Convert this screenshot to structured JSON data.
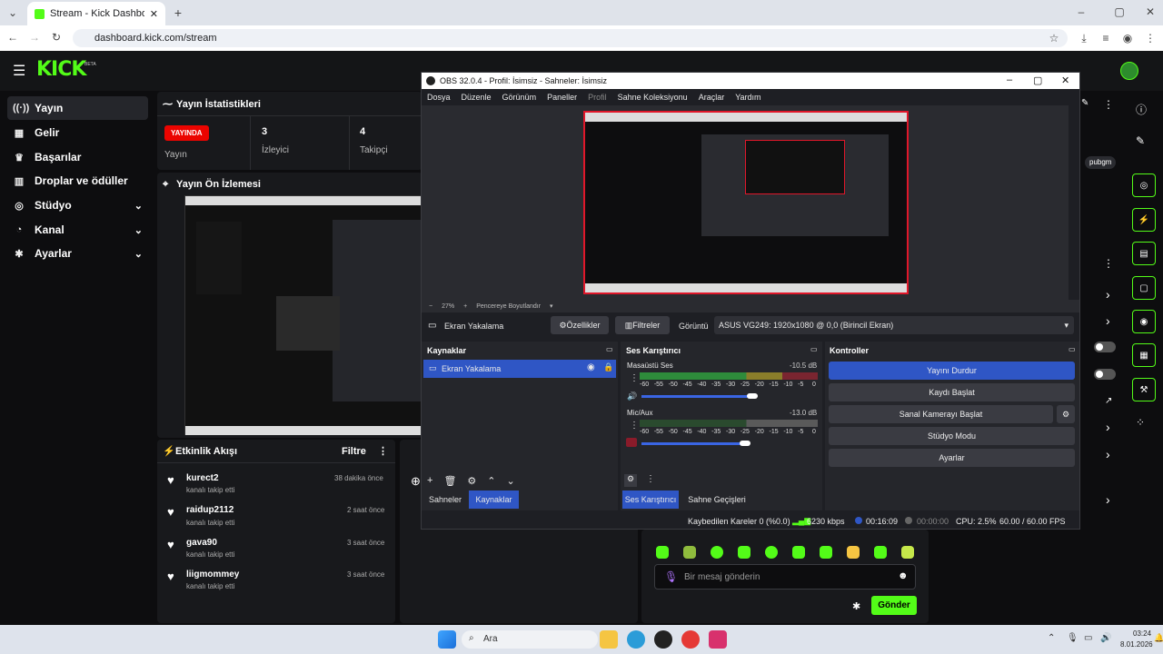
{
  "browser": {
    "tab_title": "Stream - Kick Dashboard",
    "url": "dashboard.kick.com/stream"
  },
  "kick": {
    "logo": "KICK",
    "beta": "BETA",
    "nav": [
      {
        "label": "Yayın",
        "icon": "broadcast-icon"
      },
      {
        "label": "Gelir",
        "icon": "revenue-icon"
      },
      {
        "label": "Başarılar",
        "icon": "trophy-icon"
      },
      {
        "label": "Droplar ve ödüller",
        "icon": "gift-icon"
      },
      {
        "label": "Stüdyo",
        "icon": "studio-icon"
      },
      {
        "label": "Kanal",
        "icon": "channel-icon"
      },
      {
        "label": "Ayarlar",
        "icon": "settings-icon"
      }
    ],
    "stats": {
      "title": "Yayın İstatistikleri",
      "live_badge": "YAYINDA",
      "live_label": "Yayın",
      "viewers_value": "3",
      "viewers_label": "İzleyici",
      "followers_value": "4",
      "followers_label": "Takipçi"
    },
    "preview_title": "Yayın Ön İzlemesi",
    "events": {
      "title": "Etkinlik Akışı",
      "filter": "Filtre",
      "items": [
        {
          "name": "kurect2",
          "sub": "kanalı takip etti",
          "time": "38 dakika önce"
        },
        {
          "name": "raidup2112",
          "sub": "kanalı takip etti",
          "time": "2 saat önce"
        },
        {
          "name": "gava90",
          "sub": "kanalı takip etti",
          "time": "3 saat önce"
        },
        {
          "name": "liigmommey",
          "sub": "kanalı takip etti",
          "time": "3 saat önce"
        }
      ]
    },
    "chat": {
      "placeholder": "Bir mesaj gönderin",
      "send": "Gönder",
      "user_chip": "pubgm"
    }
  },
  "obs": {
    "title": "OBS 32.0.4 - Profil: İsimsiz - Sahneler: İsimsiz",
    "menu": [
      "Dosya",
      "Düzenle",
      "Görünüm",
      "Paneller",
      "Profil",
      "Sahne Koleksiyonu",
      "Araçlar",
      "Yardım"
    ],
    "zoom": "27%",
    "fit": "Pencereye Boyutlandır",
    "source_name": "Ekran Yakalama",
    "properties": "Özellikler",
    "filters": "Filtreler",
    "display_label": "Görüntü",
    "display_value": "ASUS VG249: 1920x1080 @ 0,0 (Birincil Ekran)",
    "sources_title": "Kaynaklar",
    "source_item": "Ekran Yakalama",
    "mixer_title": "Ses Karıştırıcı",
    "desktop_audio": "Masaüstü Ses",
    "desktop_db": "-10.5 dB",
    "mic": "Mic/Aux",
    "mic_db": "-13.0 dB",
    "ticks": [
      "-60",
      "-55",
      "-50",
      "-45",
      "-40",
      "-35",
      "-30",
      "-25",
      "-20",
      "-15",
      "-10",
      "-5",
      "0"
    ],
    "controls_title": "Kontroller",
    "controls": [
      "Yayını Durdur",
      "Kaydı Başlat",
      "Sanal Kamerayı Başlat",
      "Stüdyo Modu",
      "Ayarlar"
    ],
    "tabs_left": [
      "Sahneler",
      "Kaynaklar"
    ],
    "tabs_mid": [
      "Ses Karıştırıcı",
      "Sahne Geçişleri"
    ],
    "status": {
      "dropped": "Kaybedilen Kareler 0 (%0.0)",
      "kbps": "6230 kbps",
      "live_time": "00:16:09",
      "rec_time": "00:00:00",
      "cpu": "CPU: 2.5%",
      "fps": "60.00 / 60.00 FPS"
    }
  },
  "taskbar": {
    "search": "Ara",
    "time": "03:24",
    "date": "8.01.2026"
  },
  "colors": {
    "kick_green": "#53fc18",
    "live_red": "#eb0400",
    "obs_blue": "#2f56c5"
  }
}
